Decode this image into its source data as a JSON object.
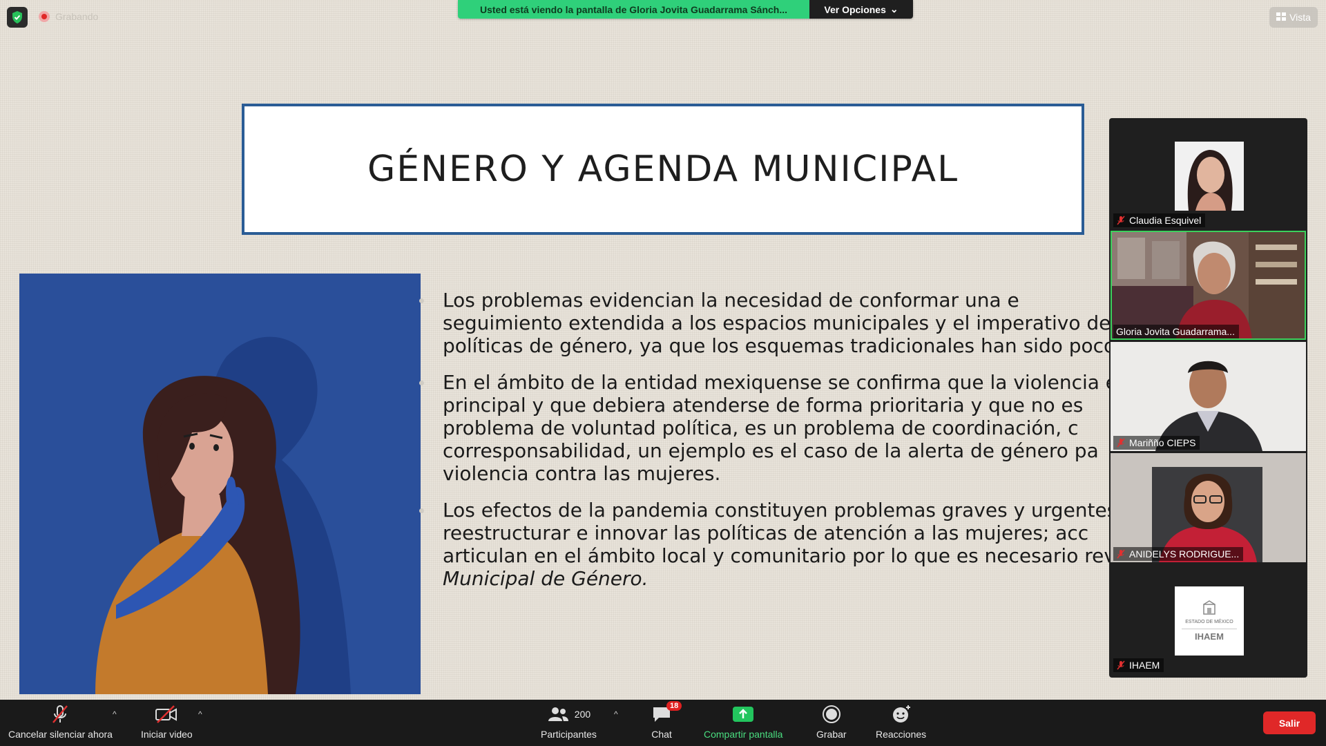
{
  "recording": {
    "label": "Grabando"
  },
  "banner": {
    "text": "Usted está viendo la pantalla de Gloria Jovita Guadarrama Sánch...",
    "options": "Ver Opciones"
  },
  "view_button": {
    "label": "Vista"
  },
  "slide": {
    "title": "GÉNERO Y AGENDA MUNICIPAL",
    "paragraphs": [
      {
        "lines": [
          "Los problemas evidencian la necesidad de conformar una e",
          "seguimiento extendida a los espacios municipales y el imperativo de i",
          "políticas de género, ya que los esquemas tradicionales han sido poco e"
        ]
      },
      {
        "lines": [
          "En el ámbito de la entidad mexiquense se confirma que la violencia e",
          "principal y que debiera atenderse de forma prioritaria y que no es",
          "problema de voluntad política, es un problema de coordinación, c",
          "corresponsabilidad, un ejemplo es el caso de la alerta de género pa",
          "violencia contra las mujeres."
        ]
      },
      {
        "lines": [
          "Los efectos de la pandemia constituyen problemas graves y urgentes c",
          "reestructurar e innovar las políticas de atención a las mujeres; acc",
          "articulan en el ámbito local y comunitario por lo que es necesario rev"
        ],
        "italic_line": "Municipal de Género."
      }
    ]
  },
  "participants": [
    {
      "name": "Claudia Esquivel",
      "muted": true
    },
    {
      "name": "Gloria Jovita Guadarrama...",
      "muted": false,
      "active": true
    },
    {
      "name": "Mariñño CIEPS",
      "muted": true
    },
    {
      "name": "ANIDELYS RODRIGUE...",
      "muted": true
    },
    {
      "name": "IHAEM",
      "muted": true,
      "logo_text": "IHAEM",
      "logo_subtext": "ESTADO DE MÉXICO"
    }
  ],
  "toolbar": {
    "mute": "Cancelar silenciar ahora",
    "video": "Iniciar video",
    "participants": "Participantes",
    "participants_count": "200",
    "chat": "Chat",
    "chat_badge": "18",
    "share": "Compartir pantalla",
    "record": "Grabar",
    "reactions": "Reacciones",
    "leave": "Salir"
  },
  "colors": {
    "share_banner": "#2fd07a",
    "share_icon": "#23c55e",
    "leave": "#e02828",
    "slide_border": "#2a5c95",
    "illustration_bg": "#2a4f9a",
    "active_speaker": "#3bd15c"
  }
}
